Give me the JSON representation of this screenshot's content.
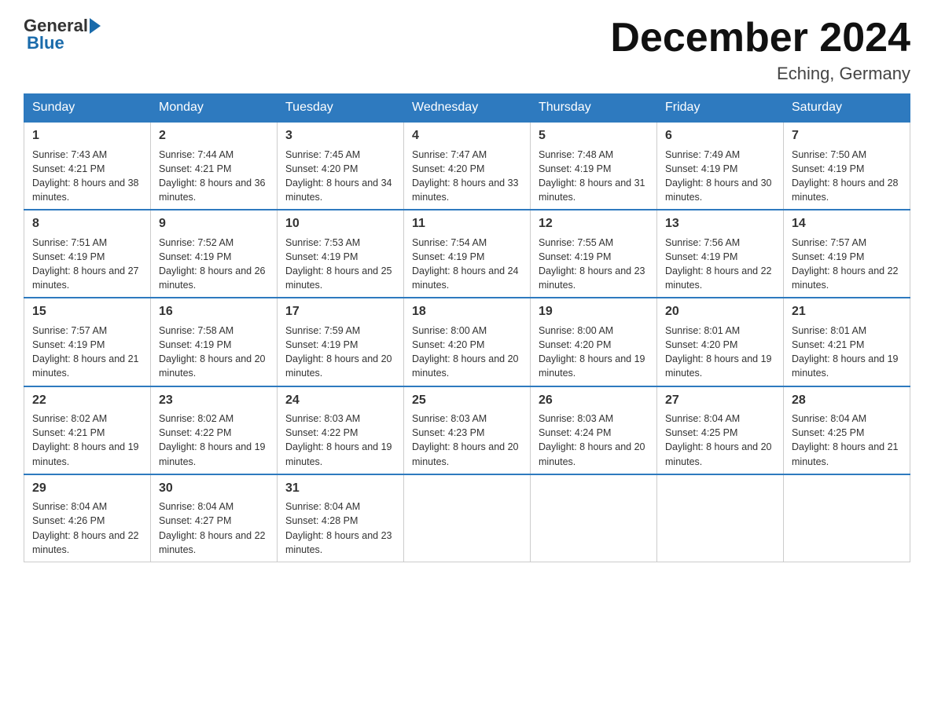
{
  "header": {
    "logo_general": "General",
    "logo_blue": "Blue",
    "month_title": "December 2024",
    "location": "Eching, Germany"
  },
  "weekdays": [
    "Sunday",
    "Monday",
    "Tuesday",
    "Wednesday",
    "Thursday",
    "Friday",
    "Saturday"
  ],
  "weeks": [
    [
      {
        "day": 1,
        "sunrise": "7:43 AM",
        "sunset": "4:21 PM",
        "daylight": "8 hours and 38 minutes."
      },
      {
        "day": 2,
        "sunrise": "7:44 AM",
        "sunset": "4:21 PM",
        "daylight": "8 hours and 36 minutes."
      },
      {
        "day": 3,
        "sunrise": "7:45 AM",
        "sunset": "4:20 PM",
        "daylight": "8 hours and 34 minutes."
      },
      {
        "day": 4,
        "sunrise": "7:47 AM",
        "sunset": "4:20 PM",
        "daylight": "8 hours and 33 minutes."
      },
      {
        "day": 5,
        "sunrise": "7:48 AM",
        "sunset": "4:19 PM",
        "daylight": "8 hours and 31 minutes."
      },
      {
        "day": 6,
        "sunrise": "7:49 AM",
        "sunset": "4:19 PM",
        "daylight": "8 hours and 30 minutes."
      },
      {
        "day": 7,
        "sunrise": "7:50 AM",
        "sunset": "4:19 PM",
        "daylight": "8 hours and 28 minutes."
      }
    ],
    [
      {
        "day": 8,
        "sunrise": "7:51 AM",
        "sunset": "4:19 PM",
        "daylight": "8 hours and 27 minutes."
      },
      {
        "day": 9,
        "sunrise": "7:52 AM",
        "sunset": "4:19 PM",
        "daylight": "8 hours and 26 minutes."
      },
      {
        "day": 10,
        "sunrise": "7:53 AM",
        "sunset": "4:19 PM",
        "daylight": "8 hours and 25 minutes."
      },
      {
        "day": 11,
        "sunrise": "7:54 AM",
        "sunset": "4:19 PM",
        "daylight": "8 hours and 24 minutes."
      },
      {
        "day": 12,
        "sunrise": "7:55 AM",
        "sunset": "4:19 PM",
        "daylight": "8 hours and 23 minutes."
      },
      {
        "day": 13,
        "sunrise": "7:56 AM",
        "sunset": "4:19 PM",
        "daylight": "8 hours and 22 minutes."
      },
      {
        "day": 14,
        "sunrise": "7:57 AM",
        "sunset": "4:19 PM",
        "daylight": "8 hours and 22 minutes."
      }
    ],
    [
      {
        "day": 15,
        "sunrise": "7:57 AM",
        "sunset": "4:19 PM",
        "daylight": "8 hours and 21 minutes."
      },
      {
        "day": 16,
        "sunrise": "7:58 AM",
        "sunset": "4:19 PM",
        "daylight": "8 hours and 20 minutes."
      },
      {
        "day": 17,
        "sunrise": "7:59 AM",
        "sunset": "4:19 PM",
        "daylight": "8 hours and 20 minutes."
      },
      {
        "day": 18,
        "sunrise": "8:00 AM",
        "sunset": "4:20 PM",
        "daylight": "8 hours and 20 minutes."
      },
      {
        "day": 19,
        "sunrise": "8:00 AM",
        "sunset": "4:20 PM",
        "daylight": "8 hours and 19 minutes."
      },
      {
        "day": 20,
        "sunrise": "8:01 AM",
        "sunset": "4:20 PM",
        "daylight": "8 hours and 19 minutes."
      },
      {
        "day": 21,
        "sunrise": "8:01 AM",
        "sunset": "4:21 PM",
        "daylight": "8 hours and 19 minutes."
      }
    ],
    [
      {
        "day": 22,
        "sunrise": "8:02 AM",
        "sunset": "4:21 PM",
        "daylight": "8 hours and 19 minutes."
      },
      {
        "day": 23,
        "sunrise": "8:02 AM",
        "sunset": "4:22 PM",
        "daylight": "8 hours and 19 minutes."
      },
      {
        "day": 24,
        "sunrise": "8:03 AM",
        "sunset": "4:22 PM",
        "daylight": "8 hours and 19 minutes."
      },
      {
        "day": 25,
        "sunrise": "8:03 AM",
        "sunset": "4:23 PM",
        "daylight": "8 hours and 20 minutes."
      },
      {
        "day": 26,
        "sunrise": "8:03 AM",
        "sunset": "4:24 PM",
        "daylight": "8 hours and 20 minutes."
      },
      {
        "day": 27,
        "sunrise": "8:04 AM",
        "sunset": "4:25 PM",
        "daylight": "8 hours and 20 minutes."
      },
      {
        "day": 28,
        "sunrise": "8:04 AM",
        "sunset": "4:25 PM",
        "daylight": "8 hours and 21 minutes."
      }
    ],
    [
      {
        "day": 29,
        "sunrise": "8:04 AM",
        "sunset": "4:26 PM",
        "daylight": "8 hours and 22 minutes."
      },
      {
        "day": 30,
        "sunrise": "8:04 AM",
        "sunset": "4:27 PM",
        "daylight": "8 hours and 22 minutes."
      },
      {
        "day": 31,
        "sunrise": "8:04 AM",
        "sunset": "4:28 PM",
        "daylight": "8 hours and 23 minutes."
      },
      null,
      null,
      null,
      null
    ]
  ]
}
